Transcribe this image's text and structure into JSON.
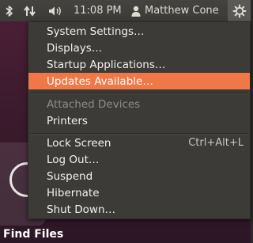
{
  "panel": {
    "clock": "11:08 PM",
    "user_name": "Matthew Cone",
    "icons": [
      "bluetooth-icon",
      "network-icon",
      "volume-icon",
      "user-icon",
      "gear-icon"
    ]
  },
  "menu": {
    "system_settings": "System Settings…",
    "displays": "Displays…",
    "startup_applications": "Startup Applications…",
    "updates_available": "Updates Available…",
    "attached_devices": "Attached Devices",
    "printers": "Printers",
    "lock_screen": "Lock Screen",
    "lock_screen_shortcut": "Ctrl+Alt+L",
    "log_out": "Log Out…",
    "suspend": "Suspend",
    "hibernate": "Hibernate",
    "shut_down": "Shut Down…"
  },
  "desktop": {
    "find_files_label": "Find Files"
  },
  "colors": {
    "panel": "#3c3b37",
    "menu_bg": "#3c3b37",
    "highlight": "#f07746",
    "text": "#f2f1ef",
    "disabled_text": "#8f8c86"
  }
}
